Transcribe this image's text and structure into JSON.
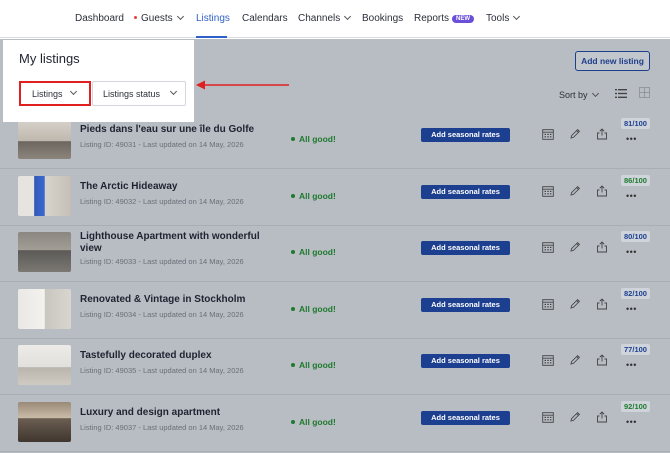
{
  "nav": {
    "items": [
      {
        "label": "Dashboard"
      },
      {
        "label": "Guests"
      },
      {
        "label": "Listings"
      },
      {
        "label": "Calendars"
      },
      {
        "label": "Channels"
      },
      {
        "label": "Bookings"
      },
      {
        "label": "Reports"
      },
      {
        "label": "Tools"
      }
    ],
    "active": "Listings",
    "reports_badge": "NEW"
  },
  "header": {
    "title": "My listings",
    "listings_filter_label": "Listings",
    "status_filter_label": "Listings status",
    "add_button_label": "Add new listing",
    "sort_label": "Sort by"
  },
  "listings": [
    {
      "title": "Pieds dans l'eau sur une île du Golfe",
      "meta": "Listing ID: 49031 - Last updated on 14 May, 2026",
      "status": "All good!",
      "action": "Add seasonal rates",
      "score": "81/100",
      "score_color": "#1c3f8f",
      "thumb": "living-room"
    },
    {
      "title": "The Arctic Hideaway",
      "meta": "Listing ID: 49032 - Last updated on 14 May, 2026",
      "status": "All good!",
      "action": "Add seasonal rates",
      "score": "86/100",
      "score_color": "#1e7a2c",
      "thumb": "blue-art-room"
    },
    {
      "title": "Lighthouse Apartment with wonderful view",
      "meta": "Listing ID: 49033 - Last updated on 14 May, 2026",
      "status": "All good!",
      "action": "Add seasonal rates",
      "score": "80/100",
      "score_color": "#1c3f8f",
      "thumb": "bedroom"
    },
    {
      "title": "Renovated & Vintage in Stockholm",
      "meta": "Listing ID: 49034 - Last updated on 14 May, 2026",
      "status": "All good!",
      "action": "Add seasonal rates",
      "score": "82/100",
      "score_color": "#1c3f8f",
      "thumb": "bright-room"
    },
    {
      "title": "Tastefully decorated duplex",
      "meta": "Listing ID: 49035 - Last updated on 14 May, 2026",
      "status": "All good!",
      "action": "Add seasonal rates",
      "score": "77/100",
      "score_color": "#1c3f8f",
      "thumb": "white-room"
    },
    {
      "title": "Luxury and design apartment",
      "meta": "Listing ID: 49037 - Last updated on 14 May, 2026",
      "status": "All good!",
      "action": "Add seasonal rates",
      "score": "92/100",
      "score_color": "#1e7a2c",
      "thumb": "dining-room"
    }
  ]
}
